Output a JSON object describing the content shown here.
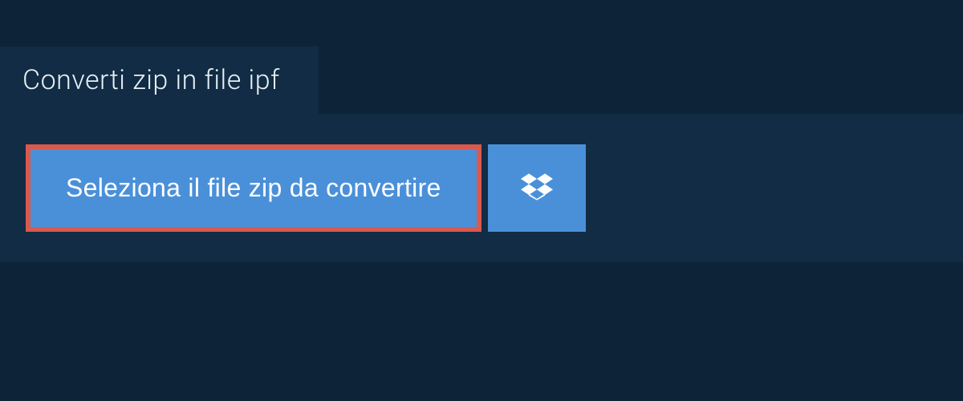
{
  "tab": {
    "label": "Converti zip in file ipf"
  },
  "actions": {
    "select_file_label": "Seleziona il file zip da convertire"
  },
  "icons": {
    "dropbox": "dropbox-icon"
  },
  "colors": {
    "background": "#0d2438",
    "panel": "#112c44",
    "button": "#4a90d9",
    "highlight_border": "#d9594c"
  }
}
